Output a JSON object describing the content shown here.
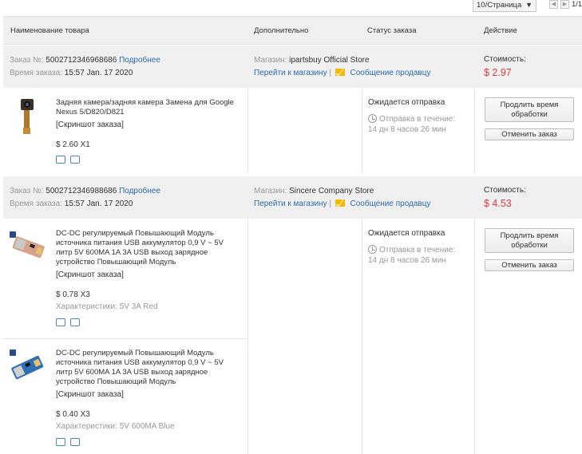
{
  "pagination": {
    "per_page": "10/Страница",
    "page": "1/1"
  },
  "table_header": {
    "product": "Наименование товара",
    "additional": "Дополнительно",
    "status": "Статус заказа",
    "action": "Действие"
  },
  "orders": [
    {
      "order_label": "Заказ №:",
      "order_no": "5002712346968686",
      "details": "Подробнее",
      "time_label": "Время заказа:",
      "time": "15:57 Jan. 17 2020",
      "store_label": "Магазин:",
      "store": "ipartsbuy Official Store",
      "go_store": "Перейти к магазину",
      "sep": "|",
      "message": "Сообщение продавцу",
      "cost_label": "Стоимость:",
      "cost": "$ 2.97",
      "items": [
        {
          "title": "Задняя камера/задняя камера Замена для Google Nexus 5/D820/D821",
          "snapshot": "[Скриншот заказа]",
          "price_qty": "$ 2.60 X1",
          "status": "Ожидается отправка",
          "ship_label": "Отправка в течение:",
          "ship_time": "14 дн 8 часов 26 мин",
          "btn_extend": "Продлить время обработки",
          "btn_cancel": "Отменить заказ"
        }
      ]
    },
    {
      "order_label": "Заказ №:",
      "order_no": "5002712346988686",
      "details": "Подробнее",
      "time_label": "Время заказа:",
      "time": "15:57 Jan. 17 2020",
      "store_label": "Магазин:",
      "store": "Sincere Company Store",
      "go_store": "Перейти к магазину",
      "sep": "|",
      "message": "Сообщение продавцу",
      "cost_label": "Стоимость:",
      "cost": "$ 4.53",
      "items": [
        {
          "title": "DC-DC регулируемый Повышающий Модуль источника питания USB аккумулятор 0,9 V ~ 5V литр 5V 600MA 1A 3A USB выход зарядное устройство Повышающий Модуль",
          "snapshot": "[Скриншот заказа]",
          "price_qty": "$ 0.78 X3",
          "specs": "Характеристики: 5V 3A Red",
          "status": "Ожидается отправка",
          "ship_label": "Отправка в течение:",
          "ship_time": "14 дн 8 часов 26 мин",
          "btn_extend": "Продлить время обработки",
          "btn_cancel": "Отменить заказ"
        },
        {
          "title": "DC-DC регулируемый Повышающий Модуль источника питания USB аккумулятор 0,9 V ~ 5V литр 5V 600MA 1A 3A USB выход зарядное устройство Повышающий Модуль",
          "snapshot": "[Скриншот заказа]",
          "price_qty": "$ 0.40 X3",
          "specs": "Характеристики: 5V 600MA Blue"
        }
      ]
    }
  ],
  "colors": {
    "link": "#2e6aad",
    "price": "#e4393c",
    "header_bg": "#f0f0f0",
    "envelope": "#f5b800"
  },
  "icons": [
    "chevron-left-icon",
    "chevron-right-icon",
    "envelope-icon",
    "clock-icon",
    "snapshot-icon",
    "shipping-icon",
    "dispute-icon"
  ]
}
